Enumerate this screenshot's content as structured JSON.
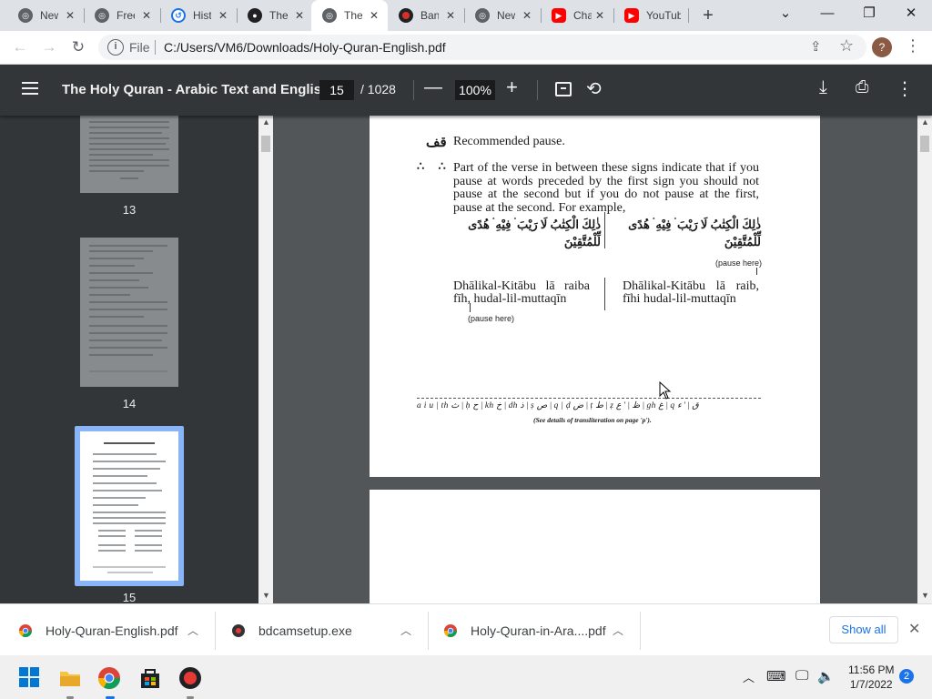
{
  "browser": {
    "tabs": [
      {
        "title": "New",
        "icon": "chrome-icon",
        "color": "#5f6368"
      },
      {
        "title": "Free",
        "icon": "chrome-icon",
        "color": "#5f6368"
      },
      {
        "title": "History",
        "icon": "history-icon",
        "color": "#1a73e8"
      },
      {
        "title": "The",
        "icon": "theater-icon",
        "color": "#202124"
      },
      {
        "title": "The",
        "icon": "chrome-icon",
        "color": "#5f6368",
        "active": true
      },
      {
        "title": "Bandicam",
        "icon": "record-icon",
        "color": "#d93025"
      },
      {
        "title": "New",
        "icon": "chrome-icon",
        "color": "#5f6368"
      },
      {
        "title": "Channel",
        "icon": "youtube-icon",
        "color": "#ff0000"
      },
      {
        "title": "YouTube",
        "icon": "youtube-icon",
        "color": "#ff0000"
      }
    ],
    "address": {
      "scheme_label": "File",
      "url": "C:/Users/VM6/Downloads/Holy-Quran-English.pdf"
    },
    "avatar_letter": "?"
  },
  "pdf": {
    "title": "The Holy Quran - Arabic Text and Englis...",
    "current_page": "15",
    "total_pages": "/ 1028",
    "zoom": "100%",
    "thumbnails": [
      {
        "label": "13"
      },
      {
        "label": "14"
      },
      {
        "label": "15",
        "active": true
      }
    ],
    "content": {
      "sym1": "قف",
      "line1": "Recommended pause.",
      "sym2": "∴ ∴",
      "para": "Part of the verse in between these signs indicate that if you pause at words preceded by the first sign you should not pause at the second but if you do not pause at the first, pause at the second. For example,",
      "arabic_left": "ذٰلِكَ الْكِتٰبُ لَا رَيْبَ ۛ فِيْهِ ۛ هُدًى لِّلْمُتَّقِيْنَ",
      "arabic_right": "ذٰلِكَ الْكِتٰبُ لَا رَيْبَ ۛ فِيْهِ ۛ هُدًى لِّلْمُتَّقِيْنَ",
      "pause_here_right": "(pause here)",
      "translit_left": "Dhālikal-Kitābu lā raiba fīh, hudal-lil-muttaqīn",
      "translit_right": "Dhālikal-Kitābu lā raib, fīhi hudal-lil-muttaqīn",
      "pause_here_left": "(pause here)",
      "translit_table": "a i u | th ث | ḥ ح | kh خ | dh ذ | ṣ ص | q | ḍ ض | ṭ ط | ẓ ظ | ' ع | gh غ | q ق | ' ء",
      "translit_note": "(See details of transliteration on page 'p')."
    }
  },
  "downloads": [
    {
      "name": "Holy-Quran-English.pdf",
      "icon": "chrome-icon"
    },
    {
      "name": "bdcamsetup.exe",
      "icon": "bandicam-icon"
    },
    {
      "name": "Holy-Quran-in-Ara....pdf",
      "icon": "chrome-icon"
    }
  ],
  "show_all_label": "Show all",
  "taskbar": {
    "time": "11:56 PM",
    "date": "1/7/2022",
    "notifications": "2"
  }
}
